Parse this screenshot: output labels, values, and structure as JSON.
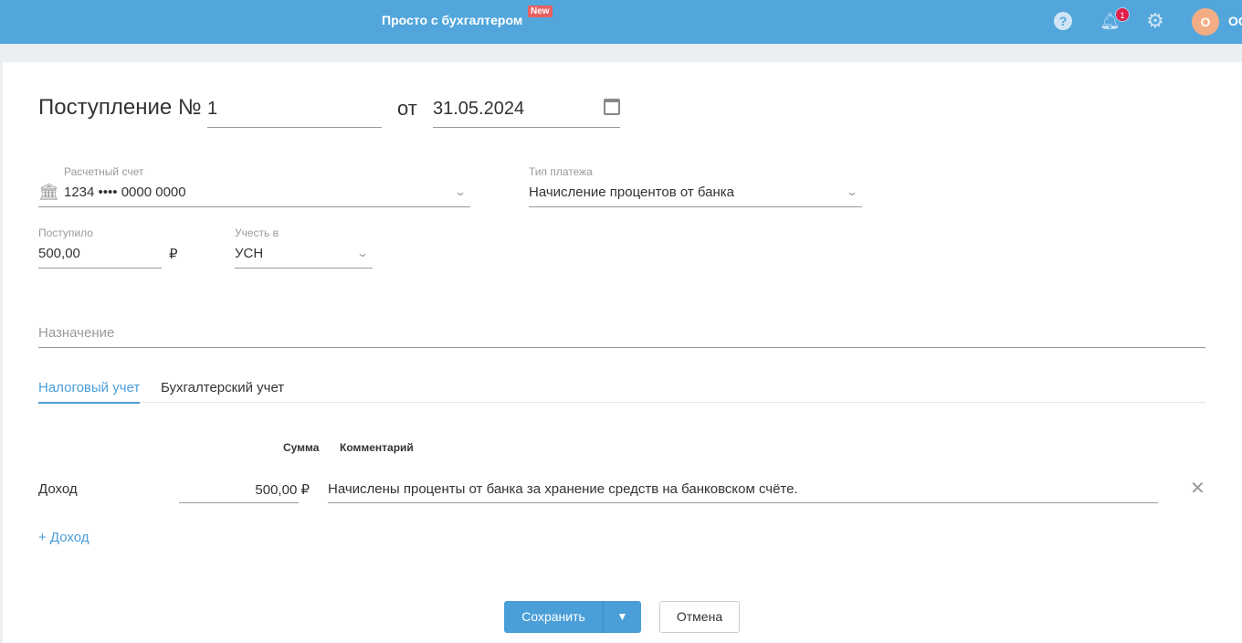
{
  "header": {
    "brand": "Просто с бухгалтером",
    "new_badge": "New",
    "notifications": "1",
    "avatar_letter": "О",
    "user": "ОО"
  },
  "form": {
    "title": "Поступление №",
    "number": "1",
    "from": "от",
    "date": "31.05.2024",
    "account": {
      "label": "Расчетный счет",
      "value": "1234 •••• 0000 0000"
    },
    "payment_type": {
      "label": "Тип платежа",
      "value": "Начисление процентов от банка"
    },
    "received": {
      "label": "Поступило",
      "value": "500,00",
      "currency": "₽"
    },
    "account_in": {
      "label": "Учесть в",
      "value": "УСН"
    },
    "purpose": {
      "placeholder": "Назначение"
    },
    "tabs": [
      {
        "label": "Налоговый учет",
        "active": true
      },
      {
        "label": "Бухгалтерский учет",
        "active": false
      }
    ],
    "table": {
      "col_sum": "Сумма",
      "col_comment": "Комментарий",
      "rows": [
        {
          "type": "Доход",
          "sum": "500,00 ₽",
          "comment": "Начислены проценты от банка за хранение средств на банковском счёте."
        }
      ]
    },
    "add_income": "+ Доход",
    "save": "Сохранить",
    "cancel": "Отмена"
  },
  "colors": {
    "header": "#52a6dc",
    "accent": "#4a9fd8",
    "badge": "#e0204a"
  }
}
